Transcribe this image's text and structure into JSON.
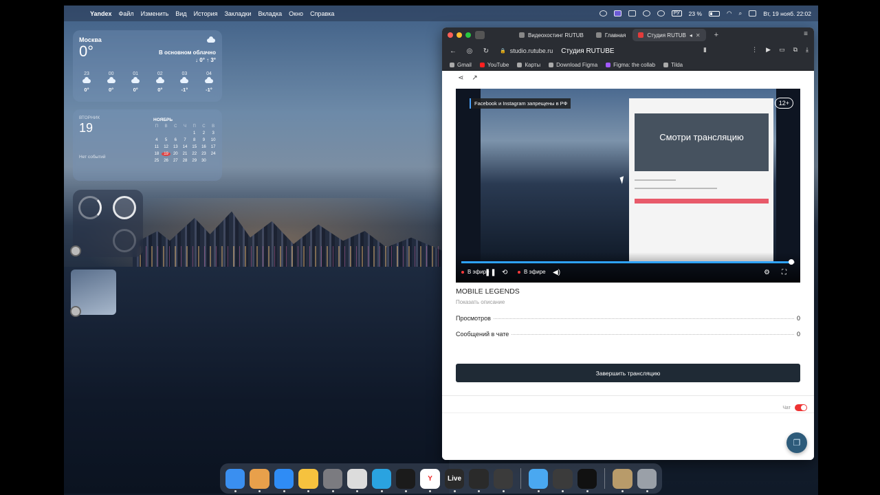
{
  "menubar": {
    "app_name": "Yandex",
    "menus": [
      "Файл",
      "Изменить",
      "Вид",
      "История",
      "Закладки",
      "Вкладка",
      "Окно",
      "Справка"
    ],
    "battery": "23 %",
    "lang": "РУ",
    "datetime": "Вт, 19 нояб. 22:02"
  },
  "weather": {
    "city": "Москва",
    "temp": "0°",
    "condition": "В основном облачно",
    "range": "↓ 0° ↑ 3°",
    "hours": [
      {
        "time": "23",
        "temp": "0°"
      },
      {
        "time": "00",
        "temp": "0°"
      },
      {
        "time": "01",
        "temp": "0°"
      },
      {
        "time": "02",
        "temp": "0°"
      },
      {
        "time": "03",
        "temp": "-1°"
      },
      {
        "time": "04",
        "temp": "-1°"
      }
    ]
  },
  "calendar": {
    "weekday": "ВТОРНИК",
    "day": "19",
    "no_events": "Нет событий",
    "month": "НОЯБРЬ",
    "headers": [
      "П",
      "В",
      "С",
      "Ч",
      "П",
      "С",
      "В"
    ],
    "cells": [
      "",
      "",
      "",
      "",
      "1",
      "2",
      "3",
      "4",
      "5",
      "6",
      "7",
      "8",
      "9",
      "10",
      "11",
      "12",
      "13",
      "14",
      "15",
      "16",
      "17",
      "18",
      "19",
      "20",
      "21",
      "22",
      "23",
      "24",
      "25",
      "26",
      "27",
      "28",
      "29",
      "30",
      ""
    ],
    "today": "19"
  },
  "browser": {
    "tabs": [
      {
        "label": "Видеохостинг RUTUB",
        "active": false
      },
      {
        "label": "Главная",
        "active": false
      },
      {
        "label": "Студия RUTUB",
        "active": true
      }
    ],
    "url_domain": "studio.rutube.ru",
    "page_title": "Студия RUTUBE",
    "bookmarks": [
      "Gmail",
      "YouTube",
      "Карты",
      "Download Figma",
      "Figma: the collab",
      "Tilda"
    ]
  },
  "player": {
    "banner": "Facebook и Instagram запрещены в РФ",
    "age": "12+",
    "inner_video_text": "Смотри трансляцию",
    "live_label": "В эфире",
    "live_label_left": "В эфире",
    "progress": 0.99
  },
  "stream": {
    "title": "MOBILE LEGENDS",
    "show_description": "Показать описание",
    "views_label": "Просмотров",
    "views_value": "0",
    "chat_messages_label": "Сообщений в чате",
    "chat_messages_value": "0",
    "end_button": "Завершить трансляцию",
    "chat_toggle_label": "Чат"
  },
  "dock": {
    "apps": [
      {
        "name": "finder-icon",
        "color": "#3a8ff0",
        "label": ""
      },
      {
        "name": "launchpad-icon",
        "color": "#e8a04b",
        "label": ""
      },
      {
        "name": "safari-icon",
        "color": "#2f8cf5",
        "label": ""
      },
      {
        "name": "photos-icon",
        "color": "#f6c23e",
        "label": ""
      },
      {
        "name": "system-settings-icon",
        "color": "#7b7b80",
        "label": ""
      },
      {
        "name": "notes-icon",
        "color": "#dcdcdc",
        "label": ""
      },
      {
        "name": "telegram-icon",
        "color": "#2aa3e0",
        "label": ""
      },
      {
        "name": "spark-icon",
        "color": "#1b1b1b",
        "label": ""
      },
      {
        "name": "yandex-browser-icon",
        "color": "#ffffff",
        "label": "Y"
      },
      {
        "name": "live-icon",
        "color": "#2a2a2a",
        "label": "Live"
      },
      {
        "name": "obs-icon",
        "color": "#2a2a2a",
        "label": ""
      },
      {
        "name": "davinci-icon",
        "color": "#3b3b3b",
        "label": ""
      }
    ],
    "apps_right": [
      {
        "name": "cloud-icon",
        "color": "#4aa8f0",
        "label": ""
      },
      {
        "name": "davinci-icon-2",
        "color": "#3b3b3b",
        "label": ""
      },
      {
        "name": "capcut-icon",
        "color": "#111111",
        "label": ""
      }
    ],
    "apps_trash": [
      {
        "name": "archive-icon",
        "color": "#b89b6a",
        "label": ""
      },
      {
        "name": "trash-icon",
        "color": "#9aa0a8",
        "label": ""
      }
    ]
  }
}
